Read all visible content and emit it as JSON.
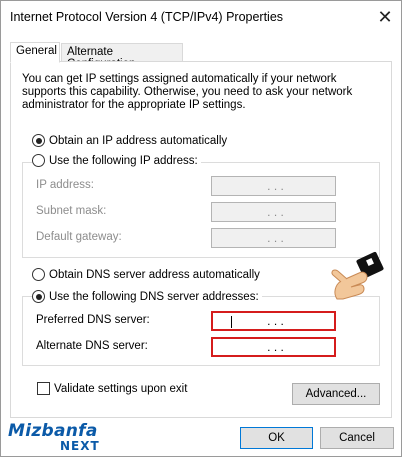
{
  "window": {
    "title": "Internet Protocol Version 4 (TCP/IPv4) Properties",
    "close_glyph": "✕"
  },
  "tabs": [
    {
      "label": "General",
      "active": true
    },
    {
      "label": "Alternate Configuration",
      "active": false
    }
  ],
  "intro_text": "You can get IP settings assigned automatically if your network supports this capability. Otherwise, you need to ask your network administrator for the appropriate IP settings.",
  "ip_section": {
    "auto_label": "Obtain an IP address automatically",
    "auto_selected": true,
    "manual_label": "Use the following IP address:",
    "manual_selected": false,
    "fields": [
      {
        "label": "IP address:",
        "value": ". . ."
      },
      {
        "label": "Subnet mask:",
        "value": ". . ."
      },
      {
        "label": "Default gateway:",
        "value": ". . ."
      }
    ]
  },
  "dns_section": {
    "auto_label": "Obtain DNS server address automatically",
    "auto_selected": false,
    "manual_label": "Use the following DNS server addresses:",
    "manual_selected": true,
    "fields": [
      {
        "label": "Preferred DNS server:",
        "value": ". . ."
      },
      {
        "label": "Alternate DNS server:",
        "value": ". . ."
      }
    ]
  },
  "validate": {
    "label": "Validate settings upon exit",
    "checked": false
  },
  "buttons": {
    "advanced": "Advanced...",
    "ok": "OK",
    "cancel": "Cancel"
  },
  "watermark": {
    "line1": "Mizbanfa",
    "line2": "NEXT"
  },
  "colors": {
    "highlight_border": "#d51c1c",
    "logo_blue": "#0b5aa8",
    "ok_border": "#0078d7"
  },
  "icons": {
    "pointer": "pointing-hand-icon"
  }
}
